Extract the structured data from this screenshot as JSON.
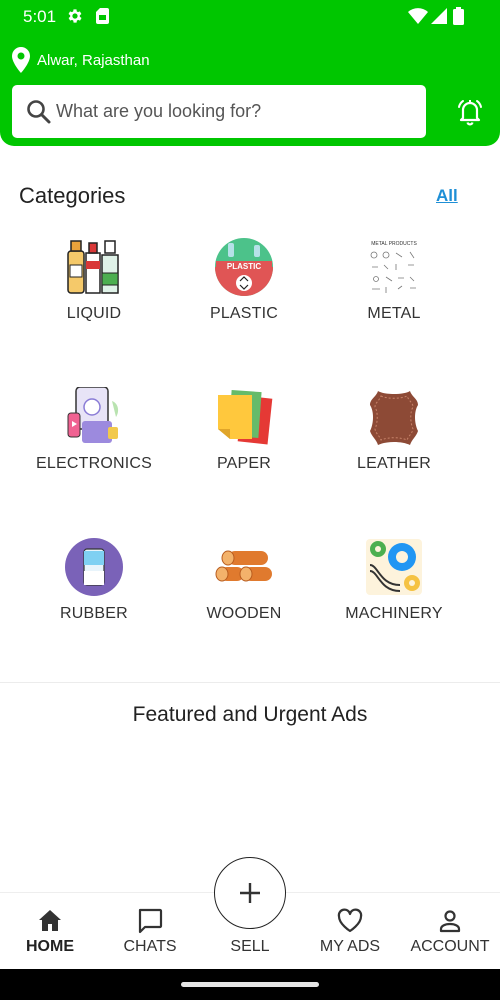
{
  "status_bar": {
    "time": "5:01"
  },
  "location": {
    "text": "Alwar, Rajasthan"
  },
  "search": {
    "placeholder": "What are you looking for?"
  },
  "categories": {
    "title": "Categories",
    "all_link": "All",
    "items": [
      {
        "label": "LIQUID",
        "icon": "bottles-icon"
      },
      {
        "label": "PLASTIC",
        "icon": "plastic-recycle-icon"
      },
      {
        "label": "METAL",
        "icon": "metal-products-icon",
        "icon_text": "METAL PRODUCTS"
      },
      {
        "label": "ELECTRONICS",
        "icon": "electronics-icon"
      },
      {
        "label": "PAPER",
        "icon": "paper-sheets-icon"
      },
      {
        "label": "LEATHER",
        "icon": "leather-hide-icon"
      },
      {
        "label": "RUBBER",
        "icon": "rubber-icon"
      },
      {
        "label": "WOODEN",
        "icon": "wood-logs-icon"
      },
      {
        "label": "MACHINERY",
        "icon": "gears-machinery-icon"
      }
    ]
  },
  "featured": {
    "title": "Featured and Urgent Ads"
  },
  "bottom_nav": {
    "items": [
      {
        "label": "HOME",
        "icon": "home-icon",
        "active": true
      },
      {
        "label": "CHATS",
        "icon": "chat-icon",
        "active": false
      },
      {
        "label": "SELL",
        "icon": "plus-icon",
        "active": false
      },
      {
        "label": "MY ADS",
        "icon": "heart-icon",
        "active": false
      },
      {
        "label": "ACCOUNT",
        "icon": "person-icon",
        "active": false
      }
    ]
  },
  "colors": {
    "brand_green": "#00c600",
    "link_blue": "#1e8fd6"
  }
}
